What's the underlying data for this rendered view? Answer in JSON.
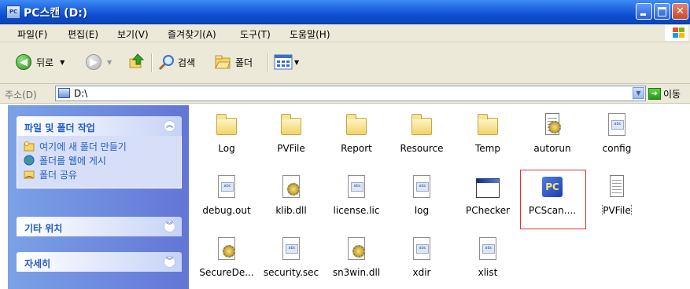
{
  "window": {
    "title": "PC스캔 (D:)",
    "app_icon": "explorer-drive-icon"
  },
  "menu": [
    "파일(F)",
    "편집(E)",
    "보기(V)",
    "즐겨찾기(A)",
    "도구(T)",
    "도움말(H)"
  ],
  "toolbar": {
    "back_label": "뒤로",
    "search_label": "검색",
    "folders_label": "폴더"
  },
  "address": {
    "label": "주소(D)",
    "value": "D:\\",
    "go_label": "이동"
  },
  "sidebar": {
    "tasks_header": "파일 및 폴더 작업",
    "tasks": [
      {
        "label": "여기에 새 폴더 만들기",
        "icon": "new-folder-icon"
      },
      {
        "label": "폴더를 웹에 게시",
        "icon": "globe-icon"
      },
      {
        "label": "폴더 공유",
        "icon": "shared-folder-icon"
      }
    ],
    "other_places_header": "기타 위치",
    "details_header": "자세히"
  },
  "files": [
    {
      "name": "Log",
      "type": "folder"
    },
    {
      "name": "PVFile",
      "type": "folder"
    },
    {
      "name": "Report",
      "type": "folder"
    },
    {
      "name": "Resource",
      "type": "folder"
    },
    {
      "name": "Temp",
      "type": "folder"
    },
    {
      "name": "autorun",
      "type": "setup-info"
    },
    {
      "name": "config",
      "type": "document"
    },
    {
      "name": "debug.out",
      "type": "document"
    },
    {
      "name": "klib.dll",
      "type": "dll"
    },
    {
      "name": "license.lic",
      "type": "document"
    },
    {
      "name": "log",
      "type": "document"
    },
    {
      "name": "PChecker",
      "type": "application"
    },
    {
      "name": "PCScan....",
      "type": "pcscan-app",
      "selected": true
    },
    {
      "name": "PVFile",
      "type": "text"
    },
    {
      "name": "SecureDe...",
      "type": "dll"
    },
    {
      "name": "security.sec",
      "type": "document"
    },
    {
      "name": "sn3win.dll",
      "type": "dll"
    },
    {
      "name": "xdir",
      "type": "document"
    },
    {
      "name": "xlist",
      "type": "document"
    }
  ],
  "colors": {
    "title_bar": "#0a4ccd",
    "sidebar_gradient_start": "#7ba2e7",
    "selection_box": "#e0332d"
  }
}
